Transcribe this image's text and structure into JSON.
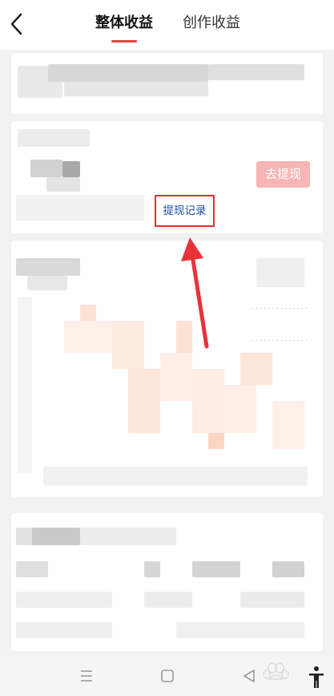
{
  "header": {
    "tabs": [
      {
        "label": "整体收益",
        "active": true
      },
      {
        "label": "创作收益",
        "active": false
      }
    ]
  },
  "balance_card": {
    "withdraw_label": "去提现",
    "withdraw_record_label": "提现记录"
  },
  "colors": {
    "accent": "#e64545",
    "withdraw_button": "#f7b5b5",
    "record_link_text": "#1e4fa8",
    "highlight_border": "#e03232"
  },
  "system_nav": {
    "icons": [
      "menu-icon",
      "home-square-icon",
      "back-triangle-icon",
      "accessibility-icon"
    ]
  }
}
